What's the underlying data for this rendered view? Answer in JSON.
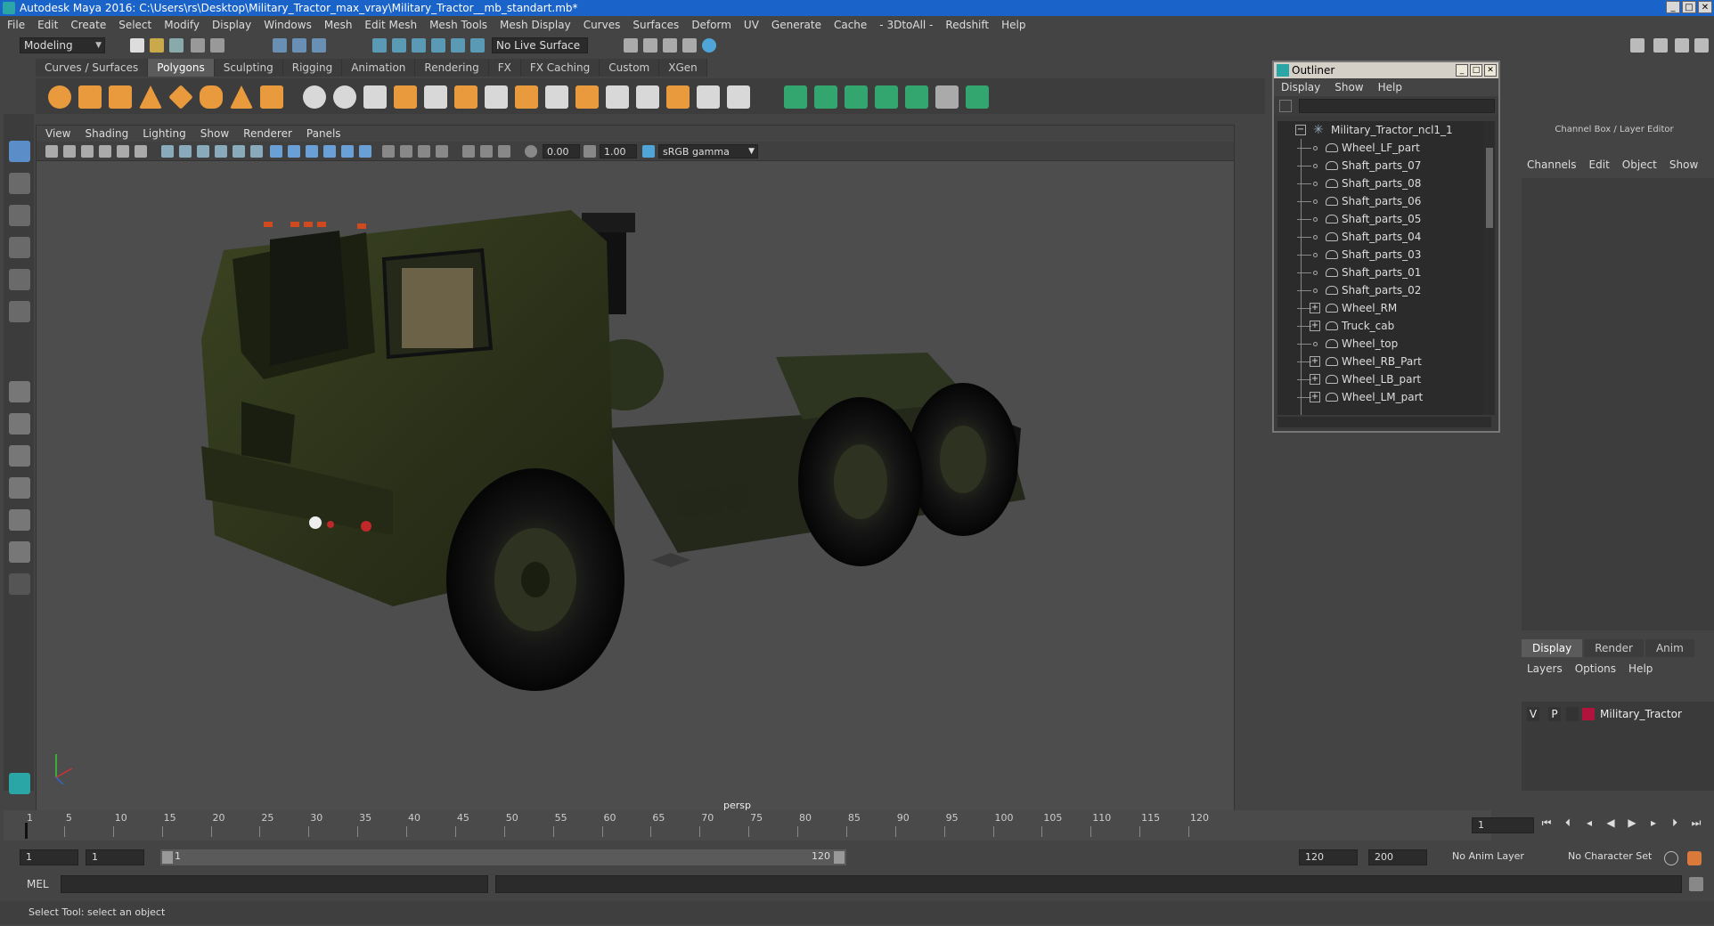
{
  "window": {
    "title": "Autodesk Maya 2016: C:\\Users\\rs\\Desktop\\Military_Tractor_max_vray\\Military_Tractor__mb_standart.mb*"
  },
  "menubar": [
    "File",
    "Edit",
    "Create",
    "Select",
    "Modify",
    "Display",
    "Windows",
    "Mesh",
    "Edit Mesh",
    "Mesh Tools",
    "Mesh Display",
    "Curves",
    "Surfaces",
    "Deform",
    "UV",
    "Generate",
    "Cache",
    "- 3DtoAll -",
    "Redshift",
    "Help"
  ],
  "statusline": {
    "mode": "Modeling",
    "live_surface": "No Live Surface"
  },
  "shelf": {
    "tabs": [
      "Curves / Surfaces",
      "Polygons",
      "Sculpting",
      "Rigging",
      "Animation",
      "Rendering",
      "FX",
      "FX Caching",
      "Custom",
      "XGen"
    ],
    "active_tab": "Polygons"
  },
  "viewport": {
    "menu": [
      "View",
      "Shading",
      "Lighting",
      "Show",
      "Renderer",
      "Panels"
    ],
    "exposure": "0.00",
    "gamma": "1.00",
    "color_space": "sRGB gamma",
    "camera": "persp"
  },
  "outliner": {
    "title": "Outliner",
    "menu": [
      "Display",
      "Show",
      "Help"
    ],
    "root": "Military_Tractor_ncl1_1",
    "items": [
      {
        "label": "Wheel_LF_part",
        "expandable": false
      },
      {
        "label": "Shaft_parts_07",
        "expandable": false
      },
      {
        "label": "Shaft_parts_08",
        "expandable": false
      },
      {
        "label": "Shaft_parts_06",
        "expandable": false
      },
      {
        "label": "Shaft_parts_05",
        "expandable": false
      },
      {
        "label": "Shaft_parts_04",
        "expandable": false
      },
      {
        "label": "Shaft_parts_03",
        "expandable": false
      },
      {
        "label": "Shaft_parts_01",
        "expandable": false
      },
      {
        "label": "Shaft_parts_02",
        "expandable": false
      },
      {
        "label": "Wheel_RM",
        "expandable": true
      },
      {
        "label": "Truck_cab",
        "expandable": true
      },
      {
        "label": "Wheel_top",
        "expandable": false
      },
      {
        "label": "Wheel_RB_Part",
        "expandable": true
      },
      {
        "label": "Wheel_LB_part",
        "expandable": true
      },
      {
        "label": "Wheel_LM_part",
        "expandable": true
      }
    ]
  },
  "channel_box": {
    "title": "Channel Box / Layer Editor",
    "menu": [
      "Channels",
      "Edit",
      "Object",
      "Show"
    ]
  },
  "layer_editor": {
    "tabs": [
      "Display",
      "Render",
      "Anim"
    ],
    "active_tab": "Display",
    "menu": [
      "Layers",
      "Options",
      "Help"
    ],
    "layers": [
      {
        "v": "V",
        "p": "P",
        "name": "Military_Tractor",
        "color": "#b0143c"
      }
    ]
  },
  "timeline": {
    "ticks": [
      1,
      5,
      10,
      15,
      20,
      25,
      30,
      35,
      40,
      45,
      50,
      55,
      60,
      65,
      70,
      75,
      80,
      85,
      90,
      95,
      100,
      105,
      110,
      115,
      120
    ],
    "current_frame": "1"
  },
  "range": {
    "start": "1",
    "playback_start": "1",
    "slider_start": "1",
    "slider_end": "120",
    "playback_end": "120",
    "end": "200",
    "anim_layer": "No Anim Layer",
    "character_set": "No Character Set"
  },
  "command_line": {
    "label": "MEL"
  },
  "help_line": {
    "text": "Select Tool: select an object"
  },
  "colors": {
    "title_bar": "#1a63c9",
    "ui_bg": "#444444",
    "viewport_bg": "#4d4d4d",
    "truck": "#2d3418",
    "layer_color": "#b0143c"
  }
}
